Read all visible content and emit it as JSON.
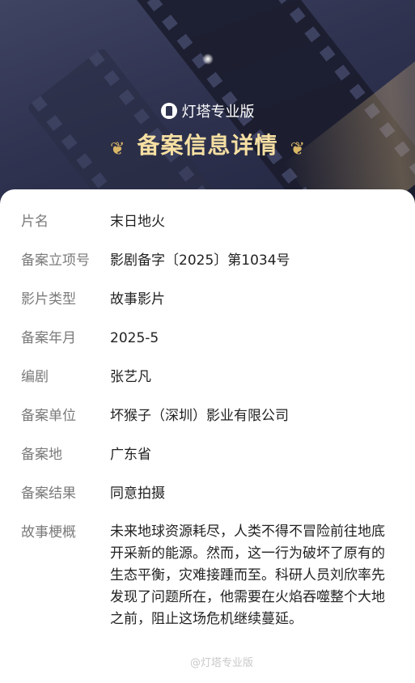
{
  "header": {
    "brand": "灯塔专业版",
    "title": "备案信息详情"
  },
  "fields": [
    {
      "label": "片名",
      "value": "末日地火"
    },
    {
      "label": "备案立项号",
      "value": "影剧备字〔2025〕第1034号"
    },
    {
      "label": "影片类型",
      "value": "故事影片"
    },
    {
      "label": "备案年月",
      "value": "2025-5"
    },
    {
      "label": "编剧",
      "value": "张艺凡"
    },
    {
      "label": "备案单位",
      "value": "坏猴子（深圳）影业有限公司"
    },
    {
      "label": "备案地",
      "value": "广东省"
    },
    {
      "label": "备案结果",
      "value": "同意拍摄"
    },
    {
      "label": "故事梗概",
      "value": "未来地球资源耗尽，人类不得不冒险前往地底开采新的能源。然而，这一行为破坏了原有的生态平衡，灾难接踵而至。科研人员刘欣率先发现了问题所在，他需要在火焰吞噬整个大地之前，阻止这场危机继续蔓延。"
    }
  ],
  "watermark": "@灯塔专业版",
  "colors": {
    "header_bg": "#2f3350",
    "title_gold": "#f5dfa2",
    "label_gray": "#7a7a7a",
    "value_dark": "#222222"
  }
}
